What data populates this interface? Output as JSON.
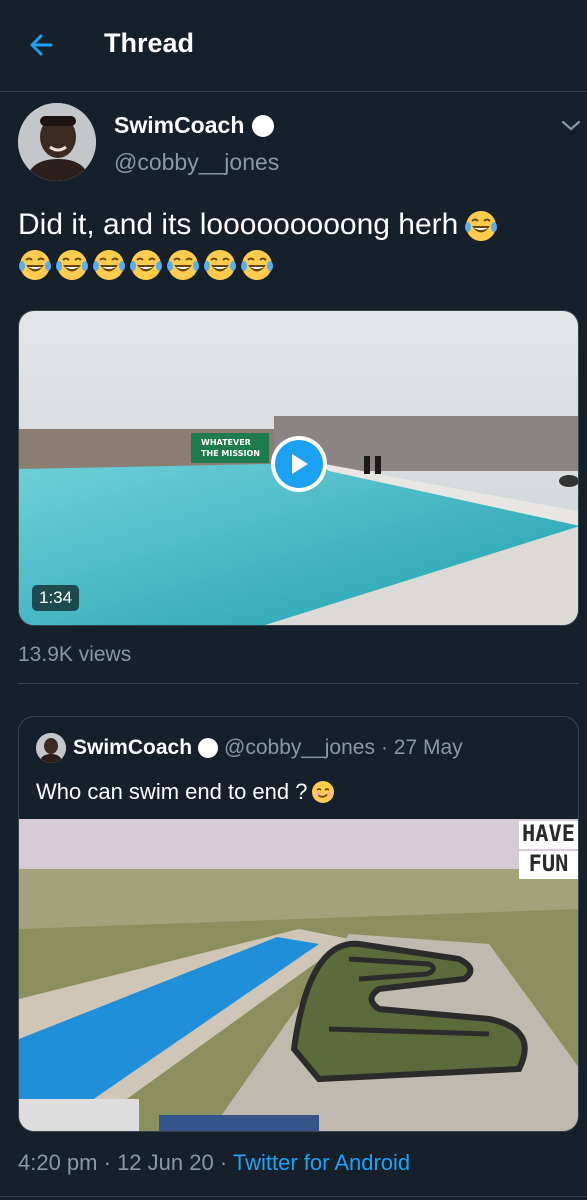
{
  "header": {
    "title": "Thread"
  },
  "tweet": {
    "author_name": "SwimCoach",
    "author_handle": "@cobby__jones",
    "text": "Did it, and its looooooooong herh",
    "emoji_count": 8,
    "video": {
      "duration": "1:34",
      "banner_line1": "WHATEVER",
      "banner_line2": "THE MISSION"
    },
    "views": "13.9K views"
  },
  "quoted": {
    "author_name": "SwimCoach",
    "author_handle": "@cobby__jones",
    "date": "· 27 May",
    "text": "Who can swim end to end ?",
    "overlay_line1": "HAVE",
    "overlay_line2": "FUN"
  },
  "footer": {
    "time": "4:20 pm",
    "date": "· 12 Jun 20 ·",
    "source": "Twitter for Android"
  },
  "colors": {
    "background": "#15202b",
    "accent": "#1da1f2",
    "muted": "#8899a6",
    "divider": "#38444d"
  },
  "icons": [
    "back-arrow-icon",
    "verified-badge-icon",
    "chevron-down-icon",
    "play-icon",
    "laughing-crying-emoji",
    "smiling-emoji"
  ]
}
